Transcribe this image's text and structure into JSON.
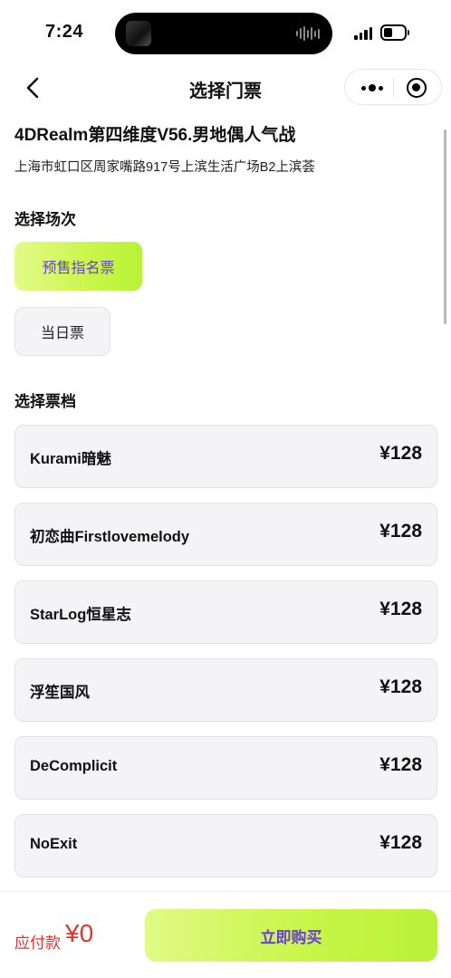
{
  "status_bar": {
    "time": "7:24"
  },
  "nav": {
    "title": "选择门票"
  },
  "event": {
    "title": "4DRealm第四维度V56.男地偶人气战",
    "address": "上海市虹口区周家嘴路917号上滨生活广场B2上滨荟"
  },
  "sessions": {
    "label": "选择场次",
    "items": [
      {
        "label": "预售指名票",
        "selected": true
      },
      {
        "label": "当日票",
        "selected": false
      }
    ]
  },
  "tiers": {
    "label": "选择票档",
    "items": [
      {
        "name": "Kurami暗魅",
        "price": "¥128"
      },
      {
        "name": "初恋曲Firstlovemelody",
        "price": "¥128"
      },
      {
        "name": "StarLog恒星志",
        "price": "¥128"
      },
      {
        "name": "浮笙国风",
        "price": "¥128"
      },
      {
        "name": "DeComplicit",
        "price": "¥128"
      },
      {
        "name": "NoExit",
        "price": "¥128"
      }
    ]
  },
  "footer": {
    "pay_label": "应付款",
    "pay_amount": "¥0",
    "buy_label": "立即购买"
  },
  "colors": {
    "accent_green": "#c8f548",
    "accent_purple": "#6a3ddc",
    "price_red": "#e8302c"
  }
}
